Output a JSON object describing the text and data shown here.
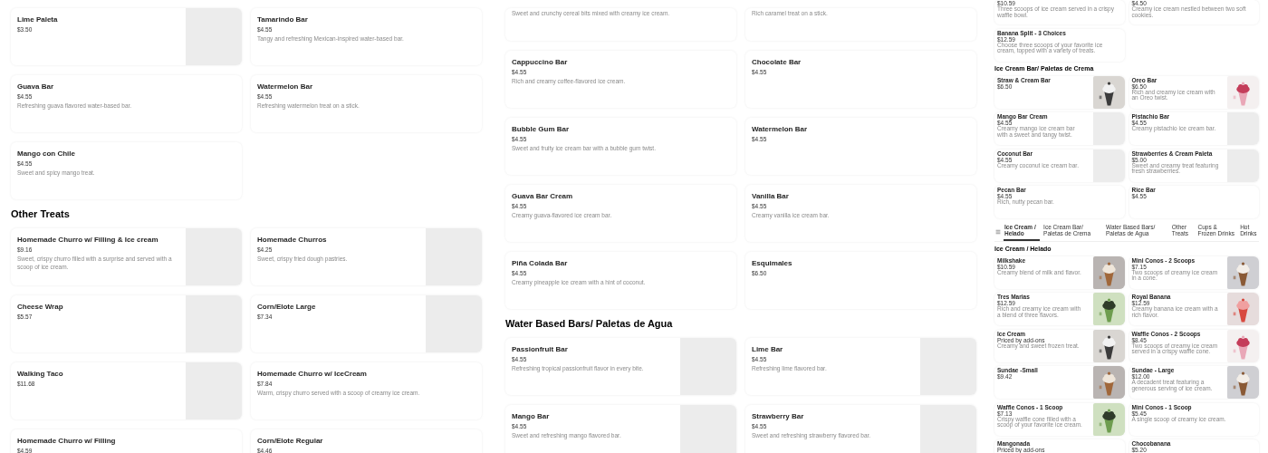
{
  "panels": [
    {
      "blocks": [
        {
          "kind": "row",
          "cards": [
            {
              "title": "Lime Paleta",
              "price": "$3.50",
              "kind": "placeholder"
            },
            {
              "title": "Tamarindo Bar",
              "price": "$4.55",
              "description": "Tangy and refreshing Mexican-inspired water-based bar.",
              "kind": "plain"
            }
          ]
        },
        {
          "kind": "row",
          "cards": [
            {
              "title": "Guava Bar",
              "price": "$4.55",
              "description": "Refreshing guava flavored water-based bar.",
              "kind": "plain"
            },
            {
              "title": "Watermelon Bar",
              "price": "$4.55",
              "description": "Refreshing watermelon treat on a stick.",
              "kind": "plain"
            }
          ]
        },
        {
          "kind": "row",
          "cards": [
            {
              "title": "Mango con Chile",
              "price": "$4.55",
              "description": "Sweet and spicy mango treat.",
              "kind": "plain"
            }
          ]
        },
        {
          "kind": "heading",
          "text": "Other Treats"
        },
        {
          "kind": "row",
          "cards": [
            {
              "title": "Homemade Churro w/ Filling & Ice cream",
              "price": "$9.16",
              "description": "Sweet, crispy churro filled with a surprise and served with a scoop of ice cream.",
              "kind": "placeholder"
            },
            {
              "title": "Homemade Churros",
              "price": "$4.25",
              "description": "Sweet, crispy fried dough pastries.",
              "kind": "placeholder"
            }
          ]
        },
        {
          "kind": "row",
          "cards": [
            {
              "title": "Cheese Wrap",
              "price": "$5.57",
              "kind": "placeholder"
            },
            {
              "title": "Corn/Elote Large",
              "price": "$7.34",
              "kind": "placeholder"
            }
          ]
        },
        {
          "kind": "row",
          "cards": [
            {
              "title": "Walking Taco",
              "price": "$11.68",
              "kind": "placeholder"
            },
            {
              "title": "Homemade Churro w/ IceCream",
              "price": "$7.84",
              "description": "Warm, crispy churro served with a scoop of creamy ice cream.",
              "kind": "plain"
            }
          ]
        },
        {
          "kind": "row",
          "cards": [
            {
              "title": "Homemade Churro w/ Filling",
              "price": "$4.59",
              "kind": "plain"
            },
            {
              "title": "Corn/Elote Regular",
              "price": "$4.46",
              "kind": "plain"
            }
          ]
        }
      ]
    },
    {
      "blocks": [
        {
          "kind": "row",
          "cards": [
            {
              "description": "Sweet and crunchy cereal bits mixed with creamy ice cream.",
              "kind": "plain"
            },
            {
              "description": "Rich caramel treat on a stick.",
              "kind": "plain"
            }
          ]
        },
        {
          "kind": "row",
          "cards": [
            {
              "title": "Cappuccino Bar",
              "price": "$4.55",
              "description": "Rich and creamy coffee-flavored ice cream.",
              "kind": "plain"
            },
            {
              "title": "Chocolate Bar",
              "price": "$4.55",
              "kind": "plain"
            }
          ]
        },
        {
          "kind": "row",
          "cards": [
            {
              "title": "Bubble Gum Bar",
              "price": "$4.55",
              "description": "Sweet and fruity ice cream bar with a bubble gum twist.",
              "kind": "plain"
            },
            {
              "title": "Watermelon Bar",
              "price": "$4.55",
              "kind": "plain"
            }
          ]
        },
        {
          "kind": "row",
          "cards": [
            {
              "title": "Guava Bar Cream",
              "price": "$4.55",
              "description": "Creamy guava-flavored ice cream bar.",
              "kind": "plain"
            },
            {
              "title": "Vanilla Bar",
              "price": "$4.55",
              "description": "Creamy vanilla ice cream bar.",
              "kind": "plain"
            }
          ]
        },
        {
          "kind": "row",
          "cards": [
            {
              "title": "Piña Colada Bar",
              "price": "$4.55",
              "description": "Creamy pineapple ice cream with a hint of coconut.",
              "kind": "plain"
            },
            {
              "title": "Esquimales",
              "price": "$6.50",
              "kind": "plain"
            }
          ]
        },
        {
          "kind": "heading",
          "text": "Water Based Bars/ Paletas de Agua"
        },
        {
          "kind": "row",
          "cards": [
            {
              "title": "Passionfruit Bar",
              "price": "$4.55",
              "description": "Refreshing tropical passionfruit flavor in every bite.",
              "kind": "placeholder"
            },
            {
              "title": "Lime Bar",
              "price": "$4.55",
              "description": "Refreshing lime flavored bar.",
              "kind": "placeholder"
            }
          ]
        },
        {
          "kind": "row",
          "cards": [
            {
              "title": "Mango Bar",
              "price": "$4.55",
              "description": "Sweet and refreshing mango flavored bar.",
              "kind": "placeholder"
            },
            {
              "title": "Strawberry Bar",
              "price": "$4.55",
              "description": "Sweet and refreshing strawberry flavored bar.",
              "kind": "placeholder"
            }
          ]
        }
      ]
    },
    {
      "blocks": [
        {
          "kind": "row",
          "cards": [
            {
              "price": "$10.59",
              "description": "Three scoops of ice cream served in a crispy waffle bowl.",
              "kind": "plain"
            },
            {
              "price": "$4.50",
              "description": "Creamy ice cream nestled between two soft cookies.",
              "kind": "plain"
            }
          ]
        },
        {
          "kind": "row",
          "cards": [
            {
              "title": "Banana Split - 3 Choices",
              "price": "$12.59",
              "description": "Choose three scoops of your favorite ice cream, topped with a variety of treats.",
              "kind": "plain"
            }
          ]
        },
        {
          "kind": "heading",
          "text": "Ice Cream Bar/ Paletas de Crema"
        },
        {
          "kind": "row",
          "cards": [
            {
              "title": "Straw & Cream Bar",
              "price": "$6.50",
              "kind": "picture"
            },
            {
              "title": "Oreo Bar",
              "price": "$6.50",
              "description": "Rich and creamy ice cream with an Oreo twist.",
              "kind": "picture"
            }
          ]
        },
        {
          "kind": "row",
          "cards": [
            {
              "title": "Mango Bar Cream",
              "price": "$4.55",
              "description": "Creamy mango ice cream bar with a sweet and tangy twist.",
              "kind": "placeholder"
            },
            {
              "title": "Pistachio Bar",
              "price": "$4.55",
              "description": "Creamy pistachio ice cream bar.",
              "kind": "placeholder"
            }
          ]
        },
        {
          "kind": "row",
          "cards": [
            {
              "title": "Coconut Bar",
              "price": "$4.55",
              "description": "Creamy coconut ice cream bar.",
              "kind": "placeholder"
            },
            {
              "title": "Strawberries & Cream Paleta",
              "price": "$5.00",
              "description": "Sweet and creamy treat featuring fresh strawberries.",
              "kind": "placeholder"
            }
          ]
        },
        {
          "kind": "row",
          "cards": [
            {
              "title": "Pecan Bar",
              "price": "$4.55",
              "description": "Rich, nutty pecan bar.",
              "kind": "plain"
            },
            {
              "title": "Rice Bar",
              "price": "$4.55",
              "kind": "plain"
            }
          ]
        },
        {
          "kind": "tabs",
          "tabs": [
            {
              "label": "Ice Cream / Helado",
              "selected": true
            },
            {
              "label": "Ice Cream Bar/ Paletas de Crema",
              "selected": false
            },
            {
              "label": "Water Based Bars/ Paletas de Agua",
              "selected": false
            },
            {
              "label": "Other Treats",
              "selected": false
            },
            {
              "label": "Cups & Frozen Drinks",
              "selected": false
            },
            {
              "label": "Hot Drinks",
              "selected": false
            }
          ]
        },
        {
          "kind": "heading",
          "text": "Ice Cream / Helado"
        },
        {
          "kind": "row",
          "cards": [
            {
              "title": "Milkshake",
              "price": "$10.59",
              "description": "Creamy blend of milk and flavor.",
              "kind": "picture"
            },
            {
              "title": "Mini Conos - 2 Scoops",
              "price": "$7.15",
              "description": "Two scoops of creamy ice cream in a cone.",
              "kind": "picture"
            }
          ]
        },
        {
          "kind": "row",
          "cards": [
            {
              "title": "Tres Marias",
              "price": "$12.59",
              "description": "Rich and creamy ice cream with a blend of three flavors.",
              "kind": "picture"
            },
            {
              "title": "Royal Banana",
              "price": "$12.59",
              "description": "Creamy banana ice cream with a rich flavor.",
              "kind": "picture"
            }
          ]
        },
        {
          "kind": "row",
          "cards": [
            {
              "title": "Ice Cream",
              "price": "Priced by add-ons",
              "description": "Creamy and sweet frozen treat.",
              "kind": "picture"
            },
            {
              "title": "Waffle Conos - 2 Scoops",
              "price": "$8.45",
              "description": "Two scoops of creamy ice cream served in a crispy waffle cone.",
              "kind": "picture"
            }
          ]
        },
        {
          "kind": "row",
          "cards": [
            {
              "title": "Sundae -Small",
              "price": "$9.42",
              "kind": "picture"
            },
            {
              "title": "Sundae - Large",
              "price": "$12.00",
              "description": "A decadent treat featuring a generous serving of ice cream.",
              "kind": "picture"
            }
          ]
        },
        {
          "kind": "row",
          "cards": [
            {
              "title": "Waffle Conos - 1 Scoop",
              "price": "$7.13",
              "description": "Crispy waffle cone filled with a scoop of your favorite ice cream.",
              "kind": "picture"
            },
            {
              "title": "Mini Conos - 1 Scoop",
              "price": "$5.45",
              "description": "A single scoop of creamy ice cream.",
              "kind": "plain"
            }
          ]
        },
        {
          "kind": "row",
          "cards": [
            {
              "title": "Mangonada",
              "price": "Priced by add-ons",
              "kind": "plain"
            },
            {
              "title": "Chocobanana",
              "price": "$5.20",
              "kind": "plain"
            }
          ]
        }
      ]
    }
  ]
}
